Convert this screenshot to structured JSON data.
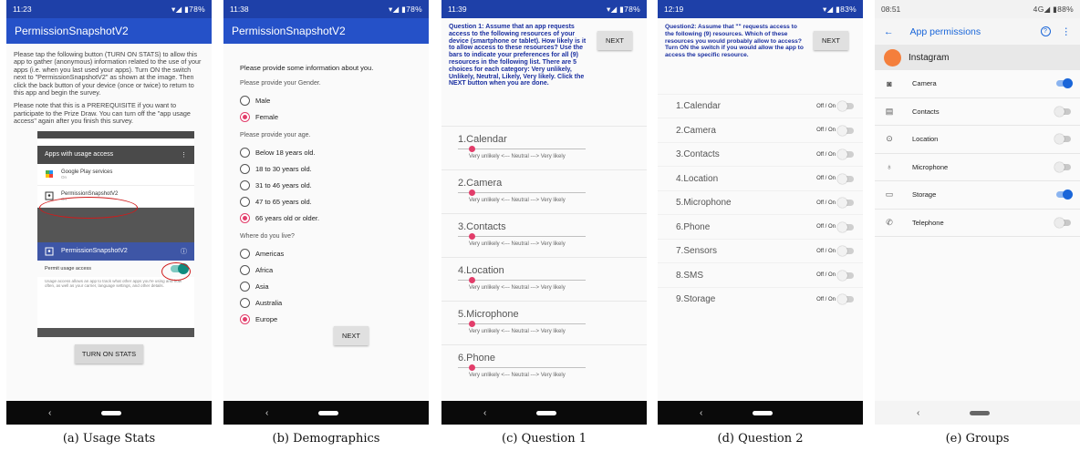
{
  "captions": [
    "(a) Usage Stats",
    "(b) Demographics",
    "(c) Question 1",
    "(d) Question 2",
    "(e) Groups"
  ],
  "phone1": {
    "time": "11:23",
    "battery": "▾◢ ▮78%",
    "title": "PermissionSnapshotV2",
    "para1": "Please tap the following button (TURN ON STATS) to allow this app to gather (anonymous) information related to the use of your apps (i.e. when you last used your apps). Turn ON the switch next to \"PermissionSnapshotV2\" as shown at the image. Then click the back button of your device (once or twice) to return to this app and begin the survey.",
    "para2": "Please note that this is a PREREQUISITE if you want to participate to the Prize Draw. You can turn off the \"app usage access\" again after you finish this survey.",
    "inset_header": "Apps with usage access",
    "inset_more": "⋮",
    "item1_name": "Google Play services",
    "item1_state": "On",
    "item2_name": "PermissionSnapshotV2",
    "item2_state": "On",
    "inset_app_title": "PermissionSnapshotV2",
    "inset_info": "ⓘ",
    "permit_label": "Permit usage access",
    "inset_desc": "Usage access allows an app to track what other apps you're using and how often, as well as your carrier, language settings, and other details.",
    "button": "TURN ON STATS"
  },
  "phone2": {
    "time": "11:38",
    "battery": "▾◢ ▮78%",
    "title": "PermissionSnapshotV2",
    "intro": "Please provide some information about you.",
    "q_gender": "Please provide your Gender.",
    "genders": [
      {
        "label": "Male",
        "selected": false
      },
      {
        "label": "Female",
        "selected": true
      }
    ],
    "q_age": "Please provide your age.",
    "ages": [
      {
        "label": "Below 18 years old.",
        "selected": false
      },
      {
        "label": "18 to 30 years old.",
        "selected": false
      },
      {
        "label": "31 to 46 years old.",
        "selected": false
      },
      {
        "label": "47 to 65 years old.",
        "selected": false
      },
      {
        "label": "66 years old or older.",
        "selected": true
      }
    ],
    "q_live": "Where do you live?",
    "regions": [
      {
        "label": "Americas",
        "selected": false
      },
      {
        "label": "Africa",
        "selected": false
      },
      {
        "label": "Asia",
        "selected": false
      },
      {
        "label": "Australia",
        "selected": false
      },
      {
        "label": "Europe",
        "selected": true
      }
    ],
    "next": "NEXT"
  },
  "phone3": {
    "time": "11:39",
    "battery": "▾◢ ▮78%",
    "question": "Question 1: Assume that an app requests access to the following resources of your device (smartphone or tablet). How likely is it to allow access to these resources? Use the bars to indicate your preferences for all (9) resources in the following list. There are 5 choices for each category: Very unlikely, Unlikely, Neutral, Likely, Very likely. Click the NEXT button when you are done.",
    "next": "NEXT",
    "scale_caption": "Very unlikely <--- Neutral ---> Very likely",
    "items": [
      "1.Calendar",
      "2.Camera",
      "3.Contacts",
      "4.Location",
      "5.Microphone",
      "6.Phone"
    ]
  },
  "phone4": {
    "time": "12:19",
    "battery": "▾◢ ▮83%",
    "question": "Question2: Assume that \"\" requests access to the following (9) resources. Which of these resources you would probably allow to access? Turn ON the switch if you would allow the app to access the specific resource.",
    "next": "NEXT",
    "switch_label": "Off / On",
    "items": [
      "1.Calendar",
      "2.Camera",
      "3.Contacts",
      "4.Location",
      "5.Microphone",
      "6.Phone",
      "7.Sensors",
      "8.SMS",
      "9.Storage"
    ]
  },
  "phone5": {
    "time": "08:51",
    "battery": "4G◢ ▮88%",
    "back": "←",
    "title": "App permissions",
    "help": "?",
    "more": "⋮",
    "app_name": "Instagram",
    "permissions": [
      {
        "label": "Camera",
        "icon": "camera-icon",
        "glyph": "◙",
        "on": true
      },
      {
        "label": "Contacts",
        "icon": "contacts-icon",
        "glyph": "▤",
        "on": false
      },
      {
        "label": "Location",
        "icon": "location-icon",
        "glyph": "⊙",
        "on": false
      },
      {
        "label": "Microphone",
        "icon": "microphone-icon",
        "glyph": "♁",
        "on": false
      },
      {
        "label": "Storage",
        "icon": "folder-icon",
        "glyph": "▭",
        "on": true
      },
      {
        "label": "Telephone",
        "icon": "phone-icon",
        "glyph": "✆",
        "on": false
      }
    ]
  },
  "nav": {
    "back": "‹"
  },
  "colors": {
    "appbar": "#2551c8",
    "accent_pink": "#e23d6a",
    "toggle_blue": "#1a66d9",
    "teal": "#118a7e",
    "question_blue": "#1a2fa0"
  }
}
